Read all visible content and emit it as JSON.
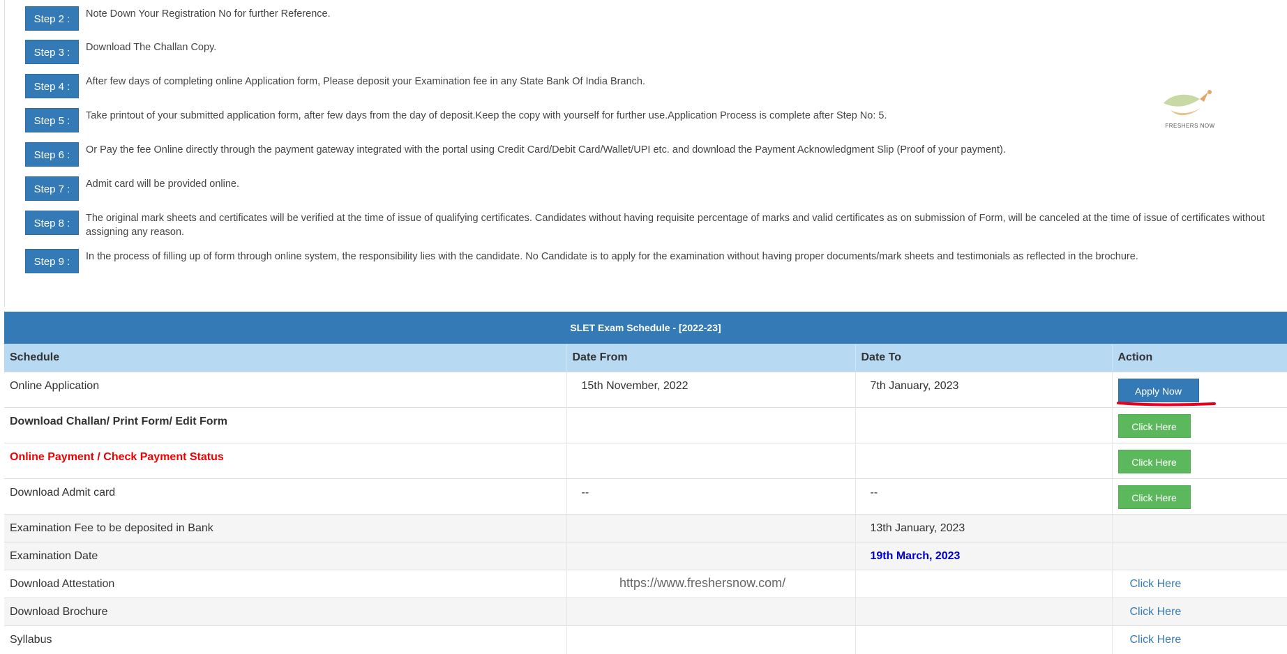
{
  "steps": [
    {
      "label": "Step 2 :",
      "text": "Note Down Your Registration No for further Reference."
    },
    {
      "label": "Step 3 :",
      "text": "Download The Challan Copy."
    },
    {
      "label": "Step 4 :",
      "text": "After few days of completing online Application form, Please deposit your Examination fee in any State Bank Of India Branch."
    },
    {
      "label": "Step 5 :",
      "text": "Take printout of your submitted application form, after few days from the day of deposit.Keep the copy with yourself for further use.Application Process is complete after Step No: 5."
    },
    {
      "label": "Step 6 :",
      "text": "Or Pay the fee Online directly through the payment gateway integrated with the portal using Credit Card/Debit Card/Wallet/UPI etc. and download the Payment Acknowledgment Slip (Proof of your payment)."
    },
    {
      "label": "Step 7 :",
      "text": "Admit card will be provided online."
    },
    {
      "label": "Step 8 :",
      "text": "The original mark sheets and certificates will be verified at the time of issue of qualifying certificates. Candidates without having requisite percentage of marks and valid certificates as on submission of Form, will be canceled at the time of issue of certificates without assigning any reason."
    },
    {
      "label": "Step 9 :",
      "text": "In the process of filling up of form through online system, the responsibility lies with the candidate. No Candidate is to apply for the examination without having proper documents/mark sheets and testimonials as reflected in the brochure."
    }
  ],
  "logo": {
    "text": "FRESHERS NOW"
  },
  "table": {
    "caption": "SLET Exam Schedule - [2022-23]",
    "headers": [
      "Schedule",
      "Date From",
      "Date To",
      "Action"
    ],
    "rows": [
      {
        "schedule": "Online Application",
        "from": "15th November, 2022",
        "to": "7th January, 2023",
        "action": "Apply Now"
      },
      {
        "schedule": "Download Challan/ Print Form/ Edit Form",
        "from": "",
        "to": "",
        "action": "Click Here"
      },
      {
        "schedule": "Online Payment / Check Payment Status",
        "from": "",
        "to": "",
        "action": "Click Here"
      },
      {
        "schedule": "Download Admit card",
        "from": "--",
        "to": "--",
        "action": "Click Here"
      },
      {
        "schedule": "Examination Fee to be deposited in Bank",
        "from": "",
        "to": "13th January, 2023",
        "action": ""
      },
      {
        "schedule": "Examination Date",
        "from": "",
        "to": "19th March, 2023",
        "action": ""
      },
      {
        "schedule": "Download Attestation",
        "from": "",
        "to": "",
        "action": "Click Here"
      },
      {
        "schedule": "Download Brochure",
        "from": "",
        "to": "",
        "action": "Click Here"
      },
      {
        "schedule": "Syllabus",
        "from": "",
        "to": "",
        "action": "Click Here"
      }
    ]
  },
  "watermark": "https://www.freshersnow.com/",
  "colors": {
    "primary": "#337ab7",
    "header_bg": "#b7d9f2",
    "success": "#5cb85c",
    "red": "#ee0000",
    "date_blue": "#0000cc",
    "annotation": "#e8001c"
  }
}
